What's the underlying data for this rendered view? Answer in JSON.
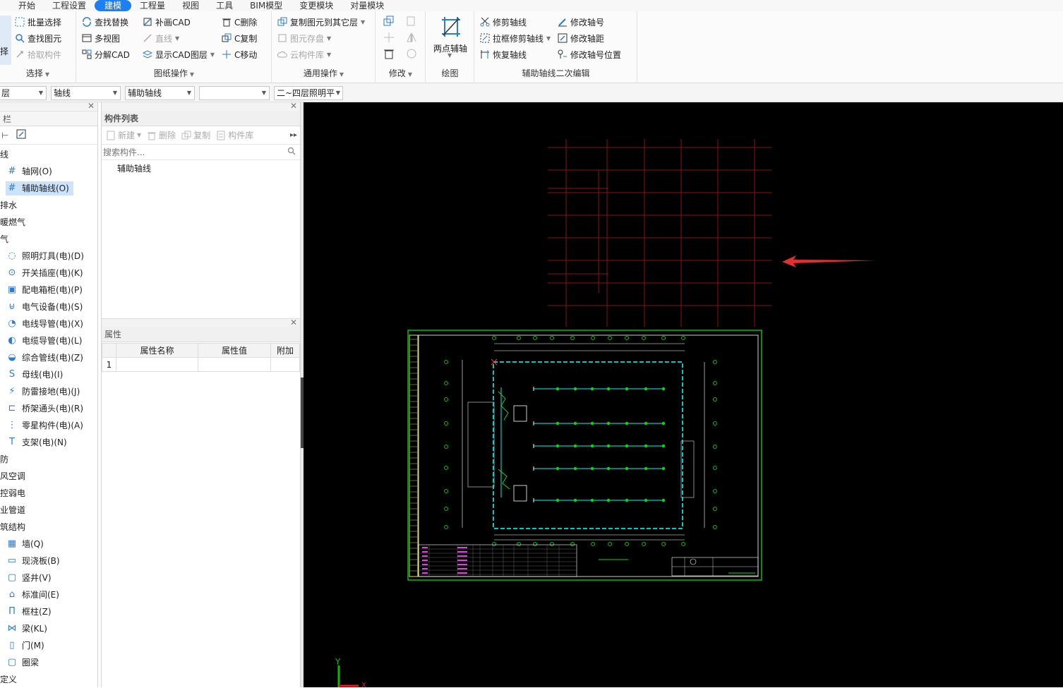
{
  "menu": {
    "items": [
      "开始",
      "工程设置",
      "建模",
      "工程量",
      "视图",
      "工具",
      "BIM模型",
      "变更模块",
      "对量模块"
    ],
    "active_index": 2
  },
  "ribbon": {
    "select_group": {
      "left_partial": "择",
      "batch_select": "批量选择",
      "find_element": "查找图元",
      "pick_component": "拾取构件",
      "label": "选择"
    },
    "drawing_group": {
      "find_replace": "查找替换",
      "multi_view": "多视图",
      "explode_cad": "分解CAD",
      "redraw_cad": "补画CAD",
      "line": "直线",
      "show_cad_layer": "显示CAD图层",
      "c_delete": "C删除",
      "c_copy": "C复制",
      "c_move": "C移动",
      "label": "图纸操作"
    },
    "common_group": {
      "copy_to_floor": "复制图元到其它层",
      "element_save": "图元存盘",
      "cloud_library": "云构件库",
      "label": "通用操作"
    },
    "modify_group": {
      "label": "修改"
    },
    "draw_group": {
      "two_point_axis": "两点辅轴",
      "label": "绘图"
    },
    "axis_edit_group": {
      "trim_axis": "修剪轴线",
      "box_trim_axis": "拉框修剪轴线",
      "restore_axis": "恢复轴线",
      "modify_axis_no": "修改轴号",
      "modify_axis_dist": "修改轴距",
      "modify_axis_pos": "修改轴号位置",
      "label": "辅助轴线二次编辑"
    }
  },
  "toolbar2": {
    "floor_partial": "层",
    "category": "轴线",
    "component_type": "辅助轴线",
    "component_name": "",
    "drawing": "二~四层照明平"
  },
  "left_panel": {
    "title": "栏",
    "items": [
      {
        "label": "线",
        "level": 0
      },
      {
        "label": "轴网(O)",
        "level": 1,
        "icon": "grid-icon"
      },
      {
        "label": "辅助轴线(O)",
        "level": 1,
        "icon": "aux-axis-icon",
        "selected": true
      },
      {
        "label": "排水",
        "level": 0
      },
      {
        "label": "暖燃气",
        "level": 0
      },
      {
        "label": "气",
        "level": 0
      },
      {
        "label": "照明灯具(电)(D)",
        "level": 1,
        "icon": "lamp-icon"
      },
      {
        "label": "开关插座(电)(K)",
        "level": 1,
        "icon": "switch-icon"
      },
      {
        "label": "配电箱柜(电)(P)",
        "level": 1,
        "icon": "panel-box-icon"
      },
      {
        "label": "电气设备(电)(S)",
        "level": 1,
        "icon": "equipment-icon"
      },
      {
        "label": "电线导管(电)(X)",
        "level": 1,
        "icon": "conduit-icon"
      },
      {
        "label": "电缆导管(电)(L)",
        "level": 1,
        "icon": "cable-icon"
      },
      {
        "label": "综合管线(电)(Z)",
        "level": 1,
        "icon": "pipeline-icon"
      },
      {
        "label": "母线(电)(I)",
        "level": 1,
        "icon": "busbar-icon"
      },
      {
        "label": "防雷接地(电)(J)",
        "level": 1,
        "icon": "grounding-icon"
      },
      {
        "label": "桥架通头(电)(R)",
        "level": 1,
        "icon": "tray-icon"
      },
      {
        "label": "零星构件(电)(A)",
        "level": 1,
        "icon": "misc-icon"
      },
      {
        "label": "支架(电)(N)",
        "level": 1,
        "icon": "bracket-icon"
      },
      {
        "label": "防",
        "level": 0
      },
      {
        "label": "风空调",
        "level": 0
      },
      {
        "label": "控弱电",
        "level": 0
      },
      {
        "label": "业管道",
        "level": 0
      },
      {
        "label": "筑结构",
        "level": 0
      },
      {
        "label": "墙(Q)",
        "level": 1,
        "icon": "wall-icon"
      },
      {
        "label": "现浇板(B)",
        "level": 1,
        "icon": "slab-icon"
      },
      {
        "label": "竖井(V)",
        "level": 1,
        "icon": "shaft-icon"
      },
      {
        "label": "标准间(E)",
        "level": 1,
        "icon": "room-icon"
      },
      {
        "label": "框柱(Z)",
        "level": 1,
        "icon": "column-icon"
      },
      {
        "label": "梁(KL)",
        "level": 1,
        "icon": "beam-icon"
      },
      {
        "label": "门(M)",
        "level": 1,
        "icon": "door-icon"
      },
      {
        "label": "圈梁",
        "level": 1,
        "icon": "ring-beam-icon"
      },
      {
        "label": "定义",
        "level": 0
      }
    ]
  },
  "component_list": {
    "title": "构件列表",
    "new": "新建",
    "delete": "删除",
    "copy": "复制",
    "library": "构件库",
    "search_placeholder": "搜索构件...",
    "items": [
      "辅助轴线"
    ]
  },
  "properties": {
    "title": "属性",
    "columns": [
      "属性名称",
      "属性值",
      "附加"
    ],
    "rows": [
      {
        "index": "1",
        "name": "",
        "value": "",
        "extra": ""
      }
    ]
  },
  "canvas": {
    "axis_y": "Y",
    "axis_x": "X",
    "colors": {
      "grid": "#8a1212",
      "arrow": "#e03030",
      "frame": "#00c000",
      "walls": "#00c8c8"
    }
  }
}
